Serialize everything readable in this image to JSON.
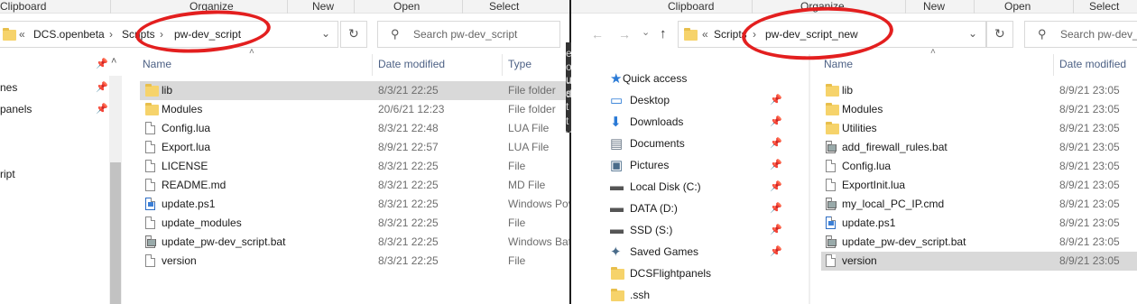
{
  "left": {
    "ribbon": [
      "Clipboard",
      "Organize",
      "New",
      "Open",
      "Select"
    ],
    "breadcrumb": {
      "overflow": "«",
      "parts": [
        "DCS.openbeta",
        "Scripts",
        "pw-dev_script"
      ]
    },
    "search_placeholder": "Search pw-dev_script",
    "columns": {
      "name": "Name",
      "date": "Date modified",
      "type": "Type"
    },
    "nav": [
      "nes",
      "panels",
      "ript"
    ],
    "files": [
      {
        "name": "lib",
        "date": "8/3/21 22:25",
        "type": "File folder",
        "icon": "folder-icon",
        "selected": true
      },
      {
        "name": "Modules",
        "date": "20/6/21 12:23",
        "type": "File folder",
        "icon": "folder-icon"
      },
      {
        "name": "Config.lua",
        "date": "8/3/21 22:48",
        "type": "LUA File",
        "icon": "file-icon"
      },
      {
        "name": "Export.lua",
        "date": "8/9/21 22:57",
        "type": "LUA File",
        "icon": "file-icon"
      },
      {
        "name": "LICENSE",
        "date": "8/3/21 22:25",
        "type": "File",
        "icon": "file-icon"
      },
      {
        "name": "README.md",
        "date": "8/3/21 22:25",
        "type": "MD File",
        "icon": "file-icon"
      },
      {
        "name": "update.ps1",
        "date": "8/3/21 22:25",
        "type": "Windows Pov",
        "icon": "powershell-file-icon"
      },
      {
        "name": "update_modules",
        "date": "8/3/21 22:25",
        "type": "File",
        "icon": "file-icon"
      },
      {
        "name": "update_pw-dev_script.bat",
        "date": "8/3/21 22:25",
        "type": "Windows Bat",
        "icon": "batch-file-icon"
      },
      {
        "name": "version",
        "date": "8/3/21 22:25",
        "type": "File",
        "icon": "file-icon"
      }
    ]
  },
  "right": {
    "ribbon": [
      "Clipboard",
      "Organize",
      "New",
      "Open",
      "Select"
    ],
    "breadcrumb": {
      "overflow": "«",
      "parts": [
        "Scripts",
        "pw-dev_script_new"
      ]
    },
    "search_placeholder": "Search pw-dev_",
    "columns": {
      "name": "Name",
      "date": "Date modified"
    },
    "nav": [
      {
        "label": "Quick access",
        "icon": "star-icon",
        "pinned": false
      },
      {
        "label": "Desktop",
        "icon": "desktop-icon",
        "pinned": true
      },
      {
        "label": "Downloads",
        "icon": "download-icon",
        "pinned": true
      },
      {
        "label": "Documents",
        "icon": "documents-icon",
        "pinned": true
      },
      {
        "label": "Pictures",
        "icon": "pictures-icon",
        "pinned": true
      },
      {
        "label": "Local Disk (C:)",
        "icon": "drive-icon",
        "pinned": true
      },
      {
        "label": "DATA (D:)",
        "icon": "drive-icon",
        "pinned": true
      },
      {
        "label": "SSD (S:)",
        "icon": "drive-icon",
        "pinned": true
      },
      {
        "label": "Saved Games",
        "icon": "saved-games-icon",
        "pinned": true
      },
      {
        "label": "DCSFlightpanels",
        "icon": "folder-icon",
        "pinned": false
      },
      {
        "label": ".ssh",
        "icon": "folder-icon",
        "pinned": false
      }
    ],
    "files": [
      {
        "name": "lib",
        "date": "8/9/21 23:05",
        "icon": "folder-icon"
      },
      {
        "name": "Modules",
        "date": "8/9/21 23:05",
        "icon": "folder-icon"
      },
      {
        "name": "Utilities",
        "date": "8/9/21 23:05",
        "icon": "folder-icon"
      },
      {
        "name": "add_firewall_rules.bat",
        "date": "8/9/21 23:05",
        "icon": "batch-file-icon"
      },
      {
        "name": "Config.lua",
        "date": "8/9/21 23:05",
        "icon": "file-icon"
      },
      {
        "name": "ExportInit.lua",
        "date": "8/9/21 23:05",
        "icon": "file-icon"
      },
      {
        "name": "my_local_PC_IP.cmd",
        "date": "8/9/21 23:05",
        "icon": "batch-file-icon"
      },
      {
        "name": "update.ps1",
        "date": "8/9/21 23:05",
        "icon": "powershell-file-icon"
      },
      {
        "name": "update_pw-dev_script.bat",
        "date": "8/9/21 23:05",
        "icon": "batch-file-icon"
      },
      {
        "name": "version",
        "date": "8/9/21 23:05",
        "icon": "file-icon",
        "selected": true
      }
    ]
  },
  "between_windows_fragments": [
    "en",
    "o u",
    "u s",
    "d t",
    "t v"
  ],
  "colors": {
    "annotation": "#e31f1f",
    "selected_row": "#d9d9d9",
    "folder": "#f6d36b"
  }
}
